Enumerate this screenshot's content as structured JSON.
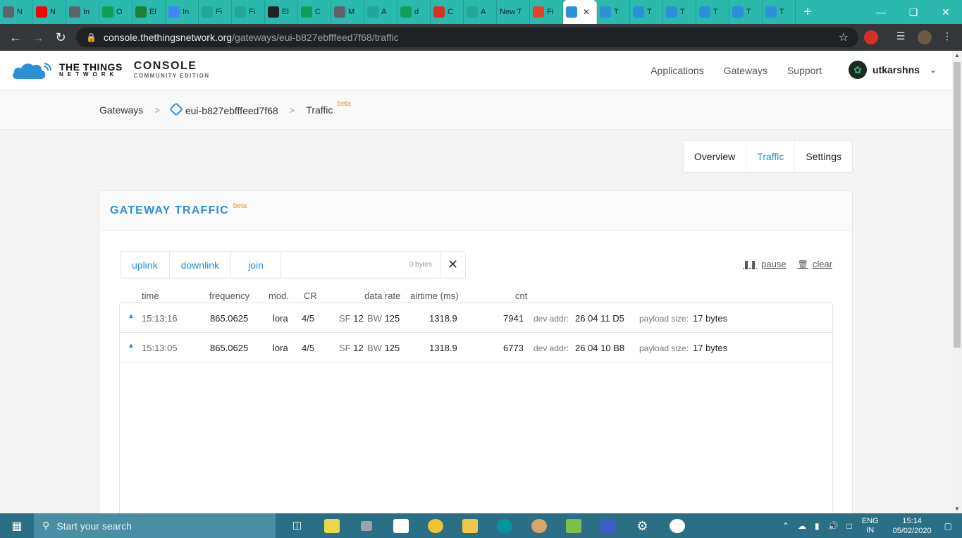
{
  "browser": {
    "tabs": [
      {
        "icon": "globe-icon",
        "title": "N",
        "color": "#5f6368"
      },
      {
        "icon": "youtube-icon",
        "title": "N",
        "color": "#ff0000"
      },
      {
        "icon": "globe-icon",
        "title": "In",
        "color": "#5f6368"
      },
      {
        "icon": "sheets-icon",
        "title": "O",
        "color": "#0f9d58"
      },
      {
        "icon": "drive-icon",
        "title": "El",
        "color": "#1a7f37"
      },
      {
        "icon": "google-icon",
        "title": "In",
        "color": "#4285f4"
      },
      {
        "icon": "mv-icon",
        "title": "Fi",
        "color": "#22a699"
      },
      {
        "icon": "mv-icon",
        "title": "Fi",
        "color": "#22a699"
      },
      {
        "icon": "penguin-icon",
        "title": "El",
        "color": "#222222"
      },
      {
        "icon": "sheets-icon",
        "title": "C",
        "color": "#0f9d58"
      },
      {
        "icon": "globe-icon",
        "title": "M",
        "color": "#5f6368"
      },
      {
        "icon": "mv-icon",
        "title": "A",
        "color": "#22a699"
      },
      {
        "icon": "sheets-icon",
        "title": "d",
        "color": "#0f9d58"
      },
      {
        "icon": "wifi-icon",
        "title": "C",
        "color": "#d93025"
      },
      {
        "icon": "mv-icon",
        "title": "A",
        "color": "#22a699"
      },
      {
        "icon": "",
        "title": "New T",
        "color": ""
      },
      {
        "icon": "gitlab-icon",
        "title": "Fi",
        "color": "#e24329"
      },
      {
        "icon": "ttn-icon",
        "title": "",
        "color": "#2d8fd5",
        "active": true
      },
      {
        "icon": "ttn-icon",
        "title": "T",
        "color": "#2d8fd5"
      },
      {
        "icon": "ttn-icon",
        "title": "T",
        "color": "#2d8fd5"
      },
      {
        "icon": "ttn-icon",
        "title": "T",
        "color": "#2d8fd5"
      },
      {
        "icon": "ttn-icon",
        "title": "T",
        "color": "#2d8fd5"
      },
      {
        "icon": "ttn-icon",
        "title": "T",
        "color": "#2d8fd5"
      },
      {
        "icon": "ttn-icon",
        "title": "T",
        "color": "#2d8fd5"
      }
    ],
    "url_host": "console.thethingsnetwork.org",
    "url_path": "/gateways/eui-b827ebfffeed7f68/traffic"
  },
  "header": {
    "logo_line1": "THE THINGS",
    "logo_line2": "NETWORK",
    "console_title": "CONSOLE",
    "console_subtitle": "COMMUNITY EDITION",
    "nav": [
      "Applications",
      "Gateways",
      "Support"
    ],
    "username": "utkarshns"
  },
  "breadcrumb": {
    "root": "Gateways",
    "gateway": "eui-b827ebfffeed7f68",
    "current": "Traffic",
    "badge": "beta"
  },
  "tabs": {
    "overview": "Overview",
    "traffic": "Traffic",
    "settings": "Settings"
  },
  "panel": {
    "title": "GATEWAY TRAFFIC",
    "badge": "beta",
    "filters": [
      "uplink",
      "downlink",
      "join"
    ],
    "search_hint": "0 bytes",
    "pause": "pause",
    "clear": "clear"
  },
  "columns": {
    "time": "time",
    "frequency": "frequency",
    "mod": "mod.",
    "cr": "CR",
    "data_rate": "data rate",
    "airtime": "airtime (ms)",
    "cnt": "cnt"
  },
  "rows": [
    {
      "time": "15:13:16",
      "frequency": "865.0625",
      "mod": "lora",
      "cr": "4/5",
      "sf_label": "SF",
      "sf": "12",
      "bw_label": "BW",
      "bw": "125",
      "airtime": "1318.9",
      "cnt": "7941",
      "dev_label": "dev addr:",
      "dev_addr": "26 04 11 D5",
      "size_label": "payload size:",
      "size": "17 bytes"
    },
    {
      "time": "15:13:05",
      "frequency": "865.0625",
      "mod": "lora",
      "cr": "4/5",
      "sf_label": "SF",
      "sf": "12",
      "bw_label": "BW",
      "bw": "125",
      "airtime": "1318.9",
      "cnt": "6773",
      "dev_label": "dev addr:",
      "dev_addr": "26 04 10 B8",
      "size_label": "payload size:",
      "size": "17 bytes"
    }
  ],
  "taskbar": {
    "search_placeholder": "Start your search",
    "lang_line1": "ENG",
    "lang_line2": "IN",
    "time": "15:14",
    "date": "05/02/2020"
  },
  "colors": {
    "accent": "#2d8fd5",
    "beta": "#e59d1a",
    "tabstrip": "#2bb8ad",
    "taskbar": "#2a6f86"
  }
}
